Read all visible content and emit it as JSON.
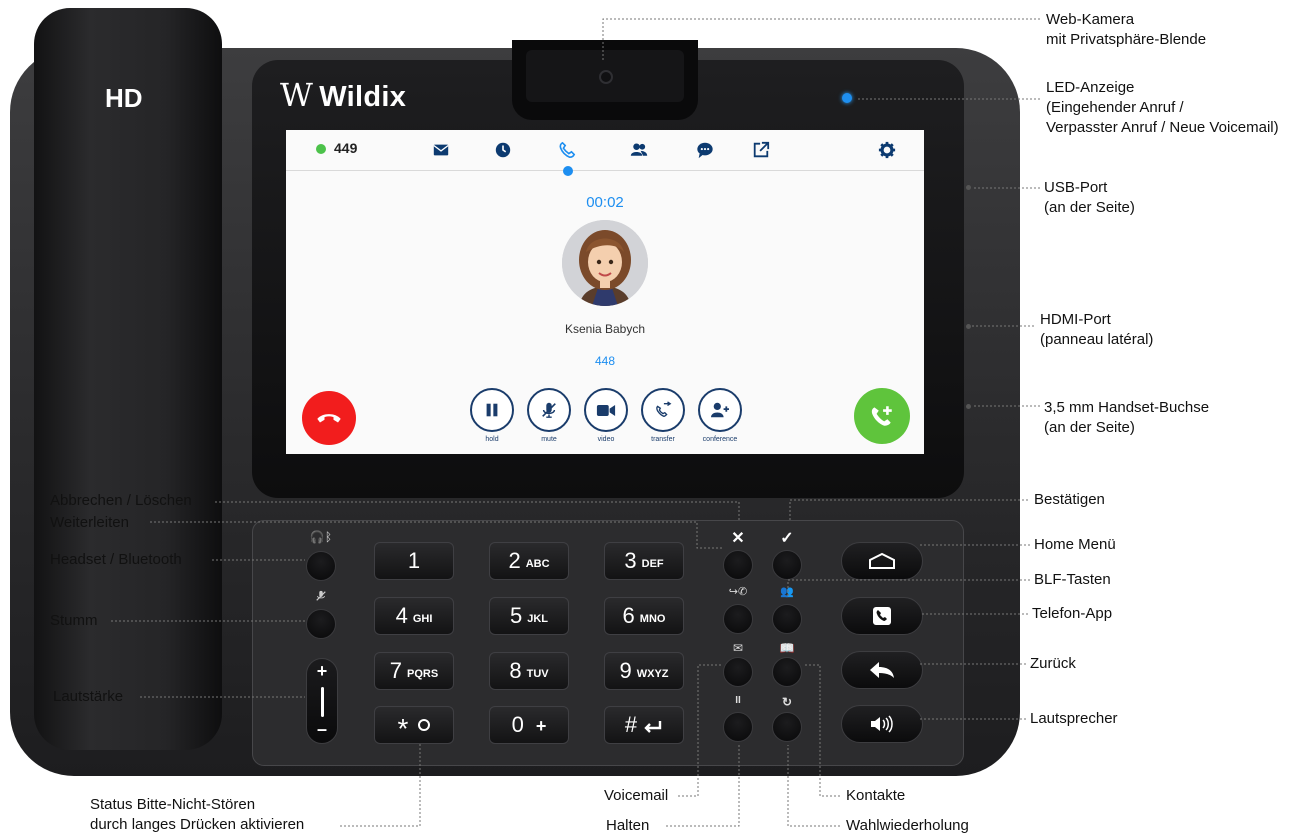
{
  "device": {
    "handset_label": "HD",
    "brand": "Wildix",
    "colors": {
      "led": "#1e8ff0",
      "accent_blue": "#1d8ef0",
      "hangup_red": "#f21d1d",
      "answer_green": "#5fc43c",
      "navy": "#0c3a70"
    }
  },
  "screen": {
    "extension": "449",
    "status_color": "#4cc24a",
    "nav_icons": [
      "envelope-icon",
      "clock-icon",
      "phone-icon",
      "contacts-icon",
      "chat-icon",
      "external-link-icon",
      "gear-icon"
    ],
    "active_nav_icon": "phone-icon",
    "call_timer": "00:02",
    "caller_name": "Ksenia Babych",
    "caller_number": "448",
    "call_buttons": [
      {
        "label": "hold",
        "icon": "pause-icon"
      },
      {
        "label": "mute",
        "icon": "mic-off-icon"
      },
      {
        "label": "video",
        "icon": "video-icon"
      },
      {
        "label": "transfer",
        "icon": "transfer-icon"
      },
      {
        "label": "conference",
        "icon": "add-user-icon"
      }
    ]
  },
  "keypad": [
    {
      "digit": "1",
      "letters": ""
    },
    {
      "digit": "2",
      "letters": "ABC"
    },
    {
      "digit": "3",
      "letters": "DEF"
    },
    {
      "digit": "4",
      "letters": "GHI"
    },
    {
      "digit": "5",
      "letters": "JKL"
    },
    {
      "digit": "6",
      "letters": "MNO"
    },
    {
      "digit": "7",
      "letters": "PQRS"
    },
    {
      "digit": "8",
      "letters": "TUV"
    },
    {
      "digit": "9",
      "letters": "WXYZ"
    },
    {
      "digit": "*",
      "letters": ""
    },
    {
      "digit": "0",
      "letters": "+"
    },
    {
      "digit": "#",
      "letters": ""
    }
  ],
  "volume": {
    "plus": "+",
    "minus": "–"
  },
  "callouts": {
    "webcam": "Web-Kamera\nmit Privatsphäre-Blende",
    "led": "LED-Anzeige\n(Eingehender Anruf /\nVerpasster Anruf / Neue Voicemail)",
    "usb": "USB-Port\n(an der Seite)",
    "hdmi": "HDMI-Port\n(panneau latéral)",
    "handset_jack": "3,5 mm Handset-Buchse\n(an der Seite)",
    "confirm": "Bestätigen",
    "home": "Home Menü",
    "blf": "BLF-Tasten",
    "phone_app": "Telefon-App",
    "back": "Zurück",
    "speaker": "Lautsprecher",
    "cancel": "Abbrechen / Löschen",
    "forward": "Weiterleiten",
    "headset": "Headset / Bluetooth",
    "mute": "Stumm",
    "volume": "Lautstärke",
    "dnd": "Status Bitte-Nicht-Stören\ndurch langes Drücken aktivieren",
    "voicemail": "Voicemail",
    "hold": "Halten",
    "contacts": "Kontakte",
    "redial": "Wahlwiederholung"
  }
}
